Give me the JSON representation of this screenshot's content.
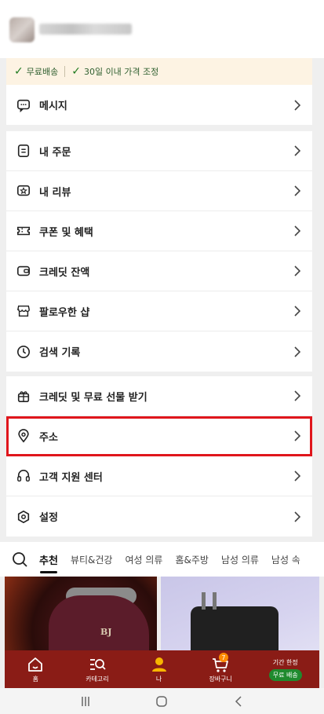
{
  "promo": {
    "item1": "무료배송",
    "item2": "30일 이내 가격 조정"
  },
  "menu": {
    "messages": "메시지",
    "orders": "내 주문",
    "reviews": "내 리뷰",
    "coupons": "쿠폰 및 혜택",
    "credit": "크레딧 잔액",
    "followed": "팔로우한 샵",
    "history": "검색 기록",
    "gifts": "크레딧 및 무료 선물 받기",
    "address": "주소",
    "support": "고객 지원 센터",
    "settings": "설정"
  },
  "tabs": [
    "추천",
    "뷰티&건강",
    "여성 의류",
    "홈&주방",
    "남성 의류",
    "남성 속"
  ],
  "products": {
    "boot_logo": "BJ"
  },
  "bottom_nav": {
    "home": "홈",
    "category": "카테고리",
    "me": "나",
    "cart": "장바구니",
    "cart_badge": "7",
    "promo_title": "기간 한정",
    "promo_tag": "무료 배송"
  },
  "colors": {
    "nav_bg": "#8a1c16",
    "highlight": "#e0161c",
    "promo_bg": "#fdf3e3",
    "accent_green": "#1f7a1f"
  }
}
